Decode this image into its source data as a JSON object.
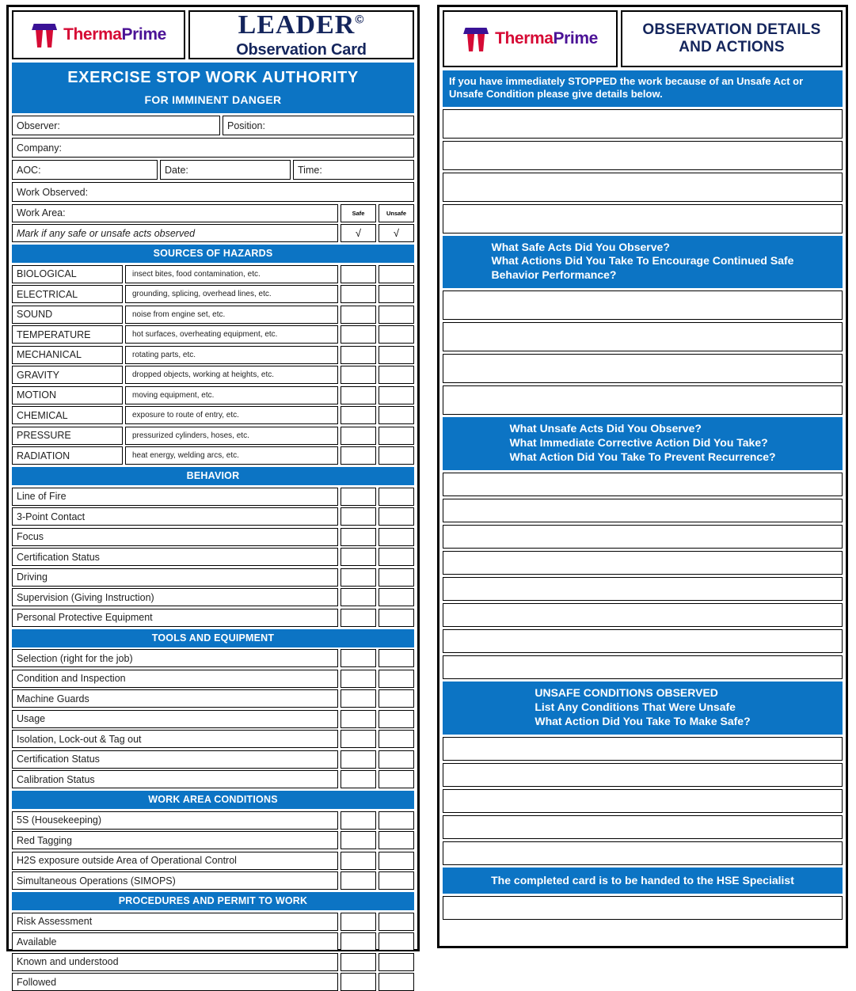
{
  "brand": {
    "logo_name": "ThermaPrime",
    "logo_part_a": "Therma",
    "logo_part_b": "Prime",
    "accent_red": "#d60b35",
    "accent_purple": "#4b1296",
    "navy": "#14255c",
    "blue": "#0c74c4"
  },
  "left_card": {
    "leader_word": "LEADER",
    "leader_copyright": "©",
    "leader_sub": "Observation Card",
    "banner_line1": "EXERCISE STOP WORK AUTHORITY",
    "banner_line2": "FOR IMMINENT DANGER",
    "fields": {
      "observer": "Observer:",
      "position": "Position:",
      "company": "Company:",
      "aoc": "AOC:",
      "date": "Date:",
      "time": "Time:",
      "work_observed": "Work Observed:",
      "work_area": "Work Area:",
      "mark_note": "Mark if any safe or unsafe acts observed"
    },
    "columns": {
      "safe": "Safe",
      "unsafe": "Unsafe",
      "check": "√"
    },
    "sections": [
      {
        "title": "SOURCES OF HAZARDS",
        "type": "hazard",
        "rows": [
          {
            "name": "BIOLOGICAL",
            "desc": "insect bites, food contamination, etc."
          },
          {
            "name": "ELECTRICAL",
            "desc": "grounding, splicing, overhead lines, etc."
          },
          {
            "name": "SOUND",
            "desc": "noise from engine set, etc."
          },
          {
            "name": "TEMPERATURE",
            "desc": "hot surfaces, overheating equipment, etc."
          },
          {
            "name": "MECHANICAL",
            "desc": "rotating parts, etc."
          },
          {
            "name": "GRAVITY",
            "desc": "dropped objects, working at heights, etc."
          },
          {
            "name": "MOTION",
            "desc": "moving equipment, etc."
          },
          {
            "name": "CHEMICAL",
            "desc": "exposure to route of entry, etc."
          },
          {
            "name": "PRESSURE",
            "desc": "pressurized cylinders, hoses, etc."
          },
          {
            "name": "RADIATION",
            "desc": "heat energy, welding arcs, etc."
          }
        ]
      },
      {
        "title": "BEHAVIOR",
        "type": "plain",
        "rows": [
          {
            "name": "Line of Fire"
          },
          {
            "name": "3-Point Contact"
          },
          {
            "name": "Focus"
          },
          {
            "name": "Certification Status"
          },
          {
            "name": "Driving"
          },
          {
            "name": "Supervision (Giving Instruction)"
          },
          {
            "name": "Personal Protective Equipment"
          }
        ]
      },
      {
        "title": "TOOLS AND EQUIPMENT",
        "type": "plain",
        "rows": [
          {
            "name": "Selection (right for the job)"
          },
          {
            "name": "Condition and Inspection"
          },
          {
            "name": "Machine Guards"
          },
          {
            "name": "Usage"
          },
          {
            "name": "Isolation, Lock-out & Tag out"
          },
          {
            "name": "Certification Status"
          },
          {
            "name": "Calibration Status"
          }
        ]
      },
      {
        "title": "WORK AREA CONDITIONS",
        "type": "plain",
        "rows": [
          {
            "name": "5S (Housekeeping)"
          },
          {
            "name": "Red Tagging"
          },
          {
            "name": "H2S exposure outside Area of Operational Control"
          },
          {
            "name": "Simultaneous Operations (SIMOPS)"
          }
        ]
      },
      {
        "title": "PROCEDURES AND PERMIT TO WORK",
        "type": "plain",
        "rows": [
          {
            "name": "Risk Assessment"
          },
          {
            "name": "Available"
          },
          {
            "name": "Known and understood"
          },
          {
            "name": "Followed"
          }
        ]
      }
    ]
  },
  "right_card": {
    "title": "OBSERVATION DETAILS AND ACTIONS",
    "title_line1": "OBSERVATION DETAILS",
    "title_line2": "AND ACTIONS",
    "stop_note": "If you have immediately STOPPED the work because of an Unsafe Act or Unsafe Condition please give details below.",
    "blocks": [
      {
        "key": "stopped",
        "lines": [],
        "blank_rows": 4
      },
      {
        "key": "safe_acts",
        "lines": [
          "What Safe Acts Did You Observe?",
          "What Actions Did You Take To Encourage Continued Safe",
          "Behavior Performance?"
        ],
        "blank_rows": 4
      },
      {
        "key": "unsafe_acts",
        "lines": [
          "What Unsafe Acts Did You Observe?",
          "What Immediate Corrective Action Did You Take?",
          "What Action Did You Take To Prevent Recurrence?"
        ],
        "blank_rows": 8
      },
      {
        "key": "unsafe_conditions",
        "lines": [
          "UNSAFE CONDITIONS OBSERVED",
          "List Any Conditions That Were Unsafe",
          "What Action Did You Take To Make Safe?"
        ],
        "blank_rows": 5
      }
    ],
    "footer": "The completed card is to be handed to the HSE Specialist",
    "footer_blank_rows": 1
  }
}
